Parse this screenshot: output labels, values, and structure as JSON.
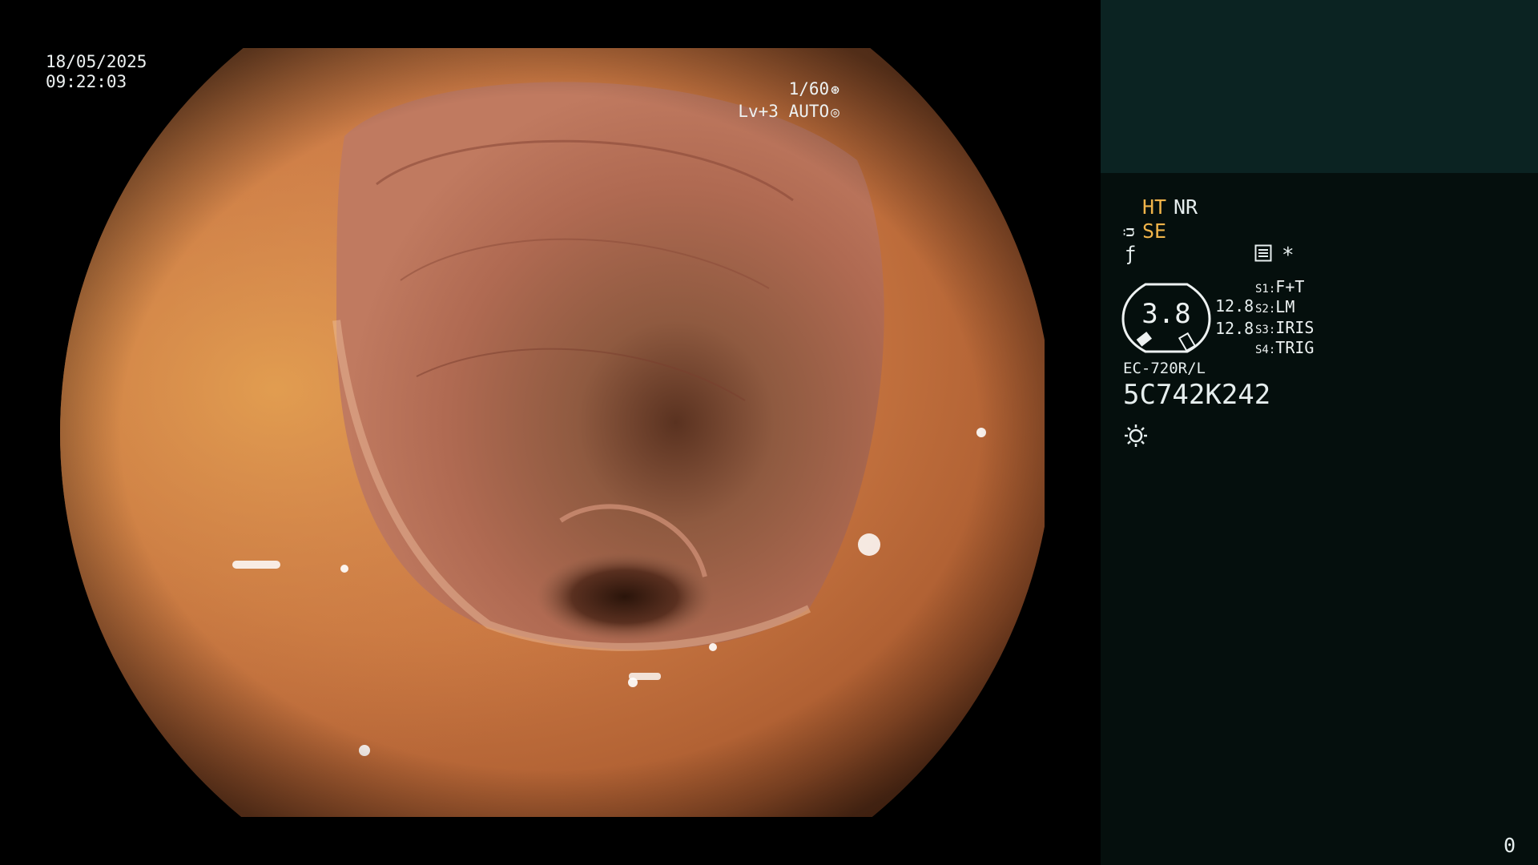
{
  "overlay": {
    "date": "18/05/2025",
    "time": "09:22:03",
    "shutter": "1/60",
    "shutter_icon": "shutter-icon",
    "level": "Lv+3 AUTO",
    "auto_icon": "aperture-icon"
  },
  "panel": {
    "ht": "HT",
    "nr": "NR",
    "scope_icon": "scope-icon",
    "se": "SE",
    "freeze_icon": "f-icon",
    "menu_icon": "list-icon",
    "star": "*",
    "gauge_value": "3.8",
    "gauge_left": "12.8",
    "gauge_right": "12.8",
    "switches": [
      {
        "key": "S1:",
        "label": "F+T"
      },
      {
        "key": "S2:",
        "label": "LM"
      },
      {
        "key": "S3:",
        "label": "IRIS"
      },
      {
        "key": "S4:",
        "label": "TRIG"
      }
    ],
    "model": "EC-720R/L",
    "serial": "5C742K242",
    "light_icon": "sun-icon",
    "counter": "0"
  },
  "colors": {
    "panel_bg": "#050f0d",
    "panel_top": "#0b2322",
    "accent": "#f0b44a",
    "text": "#e6eeee"
  }
}
